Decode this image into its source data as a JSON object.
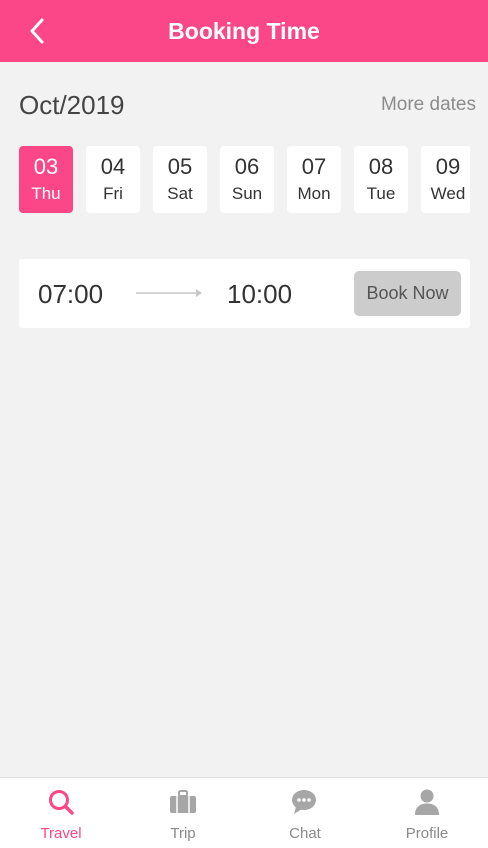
{
  "header": {
    "title": "Booking Time"
  },
  "calendar": {
    "month": "Oct/2019",
    "more_dates": "More dates",
    "dates": [
      {
        "day": "03",
        "weekday": "Thu",
        "selected": true
      },
      {
        "day": "04",
        "weekday": "Fri",
        "selected": false
      },
      {
        "day": "05",
        "weekday": "Sat",
        "selected": false
      },
      {
        "day": "06",
        "weekday": "Sun",
        "selected": false
      },
      {
        "day": "07",
        "weekday": "Mon",
        "selected": false
      },
      {
        "day": "08",
        "weekday": "Tue",
        "selected": false
      },
      {
        "day": "09",
        "weekday": "Wed",
        "selected": false
      }
    ]
  },
  "slot": {
    "start": "07:00",
    "end": "10:00",
    "button": "Book Now"
  },
  "tabbar": {
    "items": [
      {
        "label": "Travel",
        "icon": "search-icon",
        "active": true
      },
      {
        "label": "Trip",
        "icon": "suitcase-icon",
        "active": false
      },
      {
        "label": "Chat",
        "icon": "chat-icon",
        "active": false
      },
      {
        "label": "Profile",
        "icon": "person-icon",
        "active": false
      }
    ]
  },
  "colors": {
    "accent": "#fb4788",
    "background": "#f2f2f2",
    "inactive": "#a6a6a6"
  }
}
